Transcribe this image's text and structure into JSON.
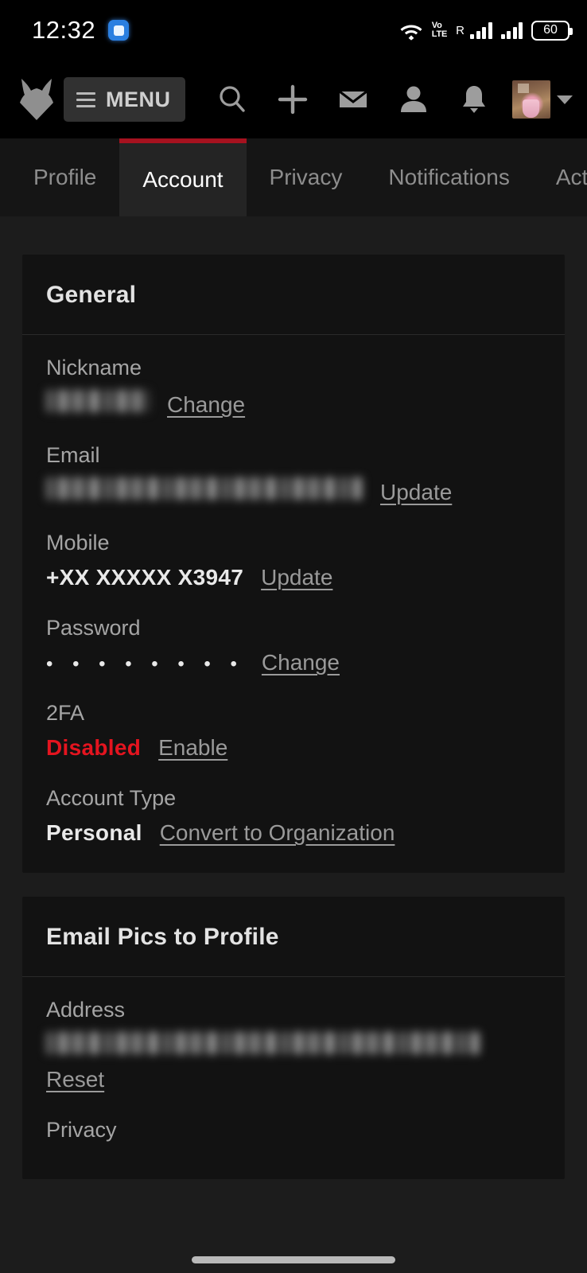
{
  "status_bar": {
    "time": "12:32",
    "notification_icon": "message-notification-icon",
    "wifi_icon": "wifi-icon",
    "network_label": "VoLTE",
    "roaming_label": "R",
    "signal_icon_1": "signal-bars-icon",
    "signal_icon_2": "signal-bars-icon",
    "battery_level": "60"
  },
  "header": {
    "logo_icon": "fox-head-logo-icon",
    "menu_label": "MENU",
    "hamburger_icon": "hamburger-icon",
    "icons": [
      {
        "name": "search-icon"
      },
      {
        "name": "plus-icon"
      },
      {
        "name": "mail-icon"
      },
      {
        "name": "person-icon"
      },
      {
        "name": "bell-icon"
      }
    ],
    "avatar_alt": "user-avatar",
    "caret_icon": "chevron-down-icon"
  },
  "tabs": [
    {
      "label": "Profile",
      "active": false
    },
    {
      "label": "Account",
      "active": true
    },
    {
      "label": "Privacy",
      "active": false
    },
    {
      "label": "Notifications",
      "active": false
    },
    {
      "label": "Activi",
      "active": false
    }
  ],
  "cards": [
    {
      "title": "General",
      "rows": [
        {
          "label": "Nickname",
          "value": "",
          "redacted": true,
          "value_bold": false,
          "link": "Change"
        },
        {
          "label": "Email",
          "value": "",
          "redacted": true,
          "value_bold": false,
          "link": "Update"
        },
        {
          "label": "Mobile",
          "value": "+XX XXXXX X3947",
          "redacted": false,
          "value_bold": true,
          "link": "Update"
        },
        {
          "label": "Password",
          "value": "• • • • • • • •",
          "redacted": false,
          "value_bold": false,
          "link": "Change"
        },
        {
          "label": "2FA",
          "value": "Disabled",
          "redacted": false,
          "value_bold": true,
          "danger": true,
          "link": "Enable"
        },
        {
          "label": "Account Type",
          "value": "Personal",
          "redacted": false,
          "value_bold": true,
          "link": "Convert to Organization"
        }
      ]
    },
    {
      "title": "Email Pics to Profile",
      "rows": [
        {
          "label": "Address",
          "value": "",
          "redacted": true,
          "value_bold": false,
          "link": "Reset",
          "link_below": true
        },
        {
          "label": "Privacy",
          "value": "",
          "redacted": false,
          "value_bold": false,
          "link": ""
        }
      ]
    }
  ],
  "colors": {
    "page_bg": "#1c1c1c",
    "card_bg": "#121212",
    "accent_red": "#a6121f",
    "danger_red": "#e4141f",
    "link_gray": "#9a9a9a"
  }
}
